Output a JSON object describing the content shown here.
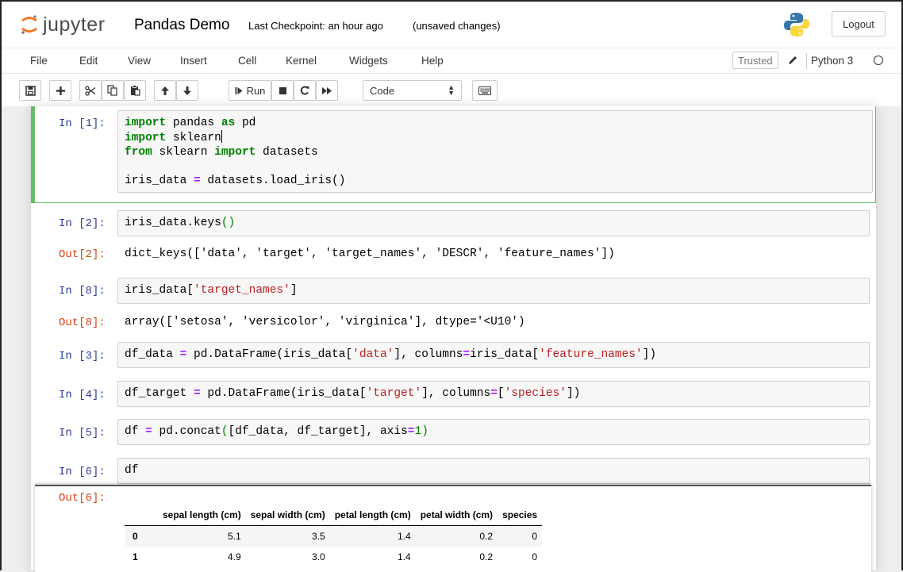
{
  "header": {
    "brand": "jupyter",
    "notebook_title": "Pandas Demo",
    "checkpoint": "Last Checkpoint: an hour ago",
    "save_status": "(unsaved changes)",
    "logout_label": "Logout"
  },
  "menu": {
    "items": [
      "File",
      "Edit",
      "View",
      "Insert",
      "Cell",
      "Kernel",
      "Widgets",
      "Help"
    ],
    "trusted_label": "Trusted",
    "kernel_name": "Python 3"
  },
  "toolbar": {
    "run_label": "Run",
    "cell_type": "Code",
    "icons": [
      "save-icon",
      "plus-icon",
      "cut-icon",
      "copy-icon",
      "paste-icon",
      "arrow-up-icon",
      "arrow-down-icon",
      "run-icon",
      "stop-icon",
      "restart-icon",
      "fast-forward-icon",
      "keyboard-icon"
    ]
  },
  "cells": {
    "c1": {
      "prompt": "In [1]:",
      "line1_kw1": "import",
      "line1_a": " pandas ",
      "line1_kw2": "as",
      "line1_b": " pd",
      "line2_kw": "import",
      "line2_a": " sklearn",
      "line3_kw1": "from",
      "line3_a": " sklearn ",
      "line3_kw2": "import",
      "line3_b": " datasets",
      "line5_a": "iris_data ",
      "line5_op": "=",
      "line5_b": " datasets.load_iris()"
    },
    "c2": {
      "prompt": "In [2]:",
      "code_a": "iris_data.keys",
      "code_paren": "()",
      "out_prompt": "Out[2]:",
      "output": "dict_keys(['data', 'target', 'target_names', 'DESCR', 'feature_names'])"
    },
    "c8": {
      "prompt": "In [8]:",
      "code_a": "iris_data[",
      "code_str": "'target_names'",
      "code_b": "]",
      "out_prompt": "Out[8]:",
      "output": "array(['setosa', 'versicolor', 'virginica'], dtype='<U10')"
    },
    "c3": {
      "prompt": "In [3]:",
      "a": "df_data ",
      "op1": "=",
      "b": " pd.DataFrame(iris_data[",
      "s1": "'data'",
      "c": "], columns",
      "op2": "=",
      "d": "iris_data[",
      "s2": "'feature_names'",
      "e": "])"
    },
    "c4": {
      "prompt": "In [4]:",
      "a": "df_target ",
      "op1": "=",
      "b": " pd.DataFrame(iris_data[",
      "s1": "'target'",
      "c": "], columns",
      "op2": "=",
      "d": "[",
      "s2": "'species'",
      "e": "])"
    },
    "c5": {
      "prompt": "In [5]:",
      "a": "df ",
      "op1": "=",
      "b": " pd.concat",
      "p1": "(",
      "c": "[df_data, df_target], axis",
      "op2": "=",
      "n": "1",
      "p2": ")"
    },
    "c6": {
      "prompt": "In [6]:",
      "code": "df",
      "out_prompt": "Out[6]:"
    }
  },
  "dataframe": {
    "columns": [
      "",
      "sepal length (cm)",
      "sepal width (cm)",
      "petal length (cm)",
      "petal width (cm)",
      "species"
    ],
    "rows": [
      [
        "0",
        "5.1",
        "3.5",
        "1.4",
        "0.2",
        "0"
      ],
      [
        "1",
        "4.9",
        "3.0",
        "1.4",
        "0.2",
        "0"
      ]
    ]
  },
  "colors": {
    "selected_cell_border": "#66bb6a",
    "in_prompt": "#303f9f",
    "out_prompt": "#d84315",
    "keyword": "#008000",
    "string": "#ba2121",
    "operator": "#aa22ff"
  }
}
